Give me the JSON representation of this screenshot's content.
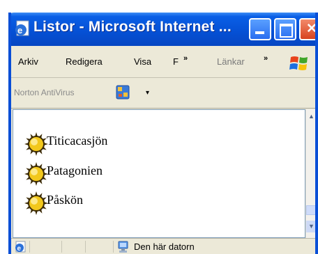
{
  "window": {
    "title": "Listor - Microsoft Internet ...",
    "icon": "ie-page-icon"
  },
  "menubar": {
    "items": [
      "Arkiv",
      "Redigera",
      "Visa",
      "F"
    ],
    "chevron": "»",
    "links_label": "Länkar",
    "links_chevron": "»"
  },
  "toolbar": {
    "norton_label": "Norton AntiVirus",
    "dropdown_arrow": "▾"
  },
  "content": {
    "items": [
      "Titicacasjön",
      "Patagonien",
      "Påskön"
    ],
    "bullet_icon": "sun-bullet-icon"
  },
  "scrollbar": {
    "up_arrow": "▲",
    "down_arrow": "▼"
  },
  "statusbar": {
    "zone_text": "Den här datorn"
  },
  "colors": {
    "titlebar": "#0551d6",
    "chrome": "#ece9d8",
    "close_button": "#d8431f"
  }
}
